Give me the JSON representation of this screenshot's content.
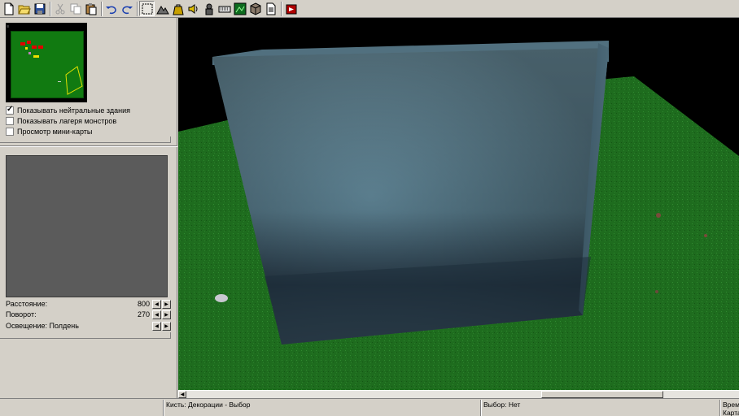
{
  "toolbar": {
    "buttons": [
      {
        "name": "new-file-icon"
      },
      {
        "name": "open-folder-icon"
      },
      {
        "name": "save-icon"
      },
      {
        "name": "cut-icon"
      },
      {
        "name": "copy-icon"
      },
      {
        "name": "paste-icon"
      },
      {
        "name": "undo-icon"
      },
      {
        "name": "redo-icon"
      },
      {
        "name": "select-icon"
      },
      {
        "name": "terrain-icon"
      },
      {
        "name": "bag-icon"
      },
      {
        "name": "sound-icon"
      },
      {
        "name": "unit-icon"
      },
      {
        "name": "keyboard-icon"
      },
      {
        "name": "map-icon"
      },
      {
        "name": "cube-icon"
      },
      {
        "name": "document-icon"
      },
      {
        "name": "test-map-icon"
      }
    ]
  },
  "left_panel": {
    "checkboxes": [
      {
        "label": "Показывать нейтральные здания",
        "checked": true
      },
      {
        "label": "Показывать лагеря монстров",
        "checked": false
      },
      {
        "label": "Просмотр мини-карты",
        "checked": false
      }
    ],
    "properties": {
      "distance_label": "Расстояние:",
      "distance_value": "800",
      "rotation_label": "Поворот:",
      "rotation_value": "270",
      "lighting_label": "Освещение: Полдень"
    }
  },
  "statusbar": {
    "brush": "Кисть: Декорации - Выбор",
    "selection": "Выбор: Нет",
    "time": "Врем",
    "map": "Карта"
  },
  "colors": {
    "chrome": "#d4d0c8",
    "grass": "#1f6e1f",
    "wall": "#5b7f8f"
  }
}
